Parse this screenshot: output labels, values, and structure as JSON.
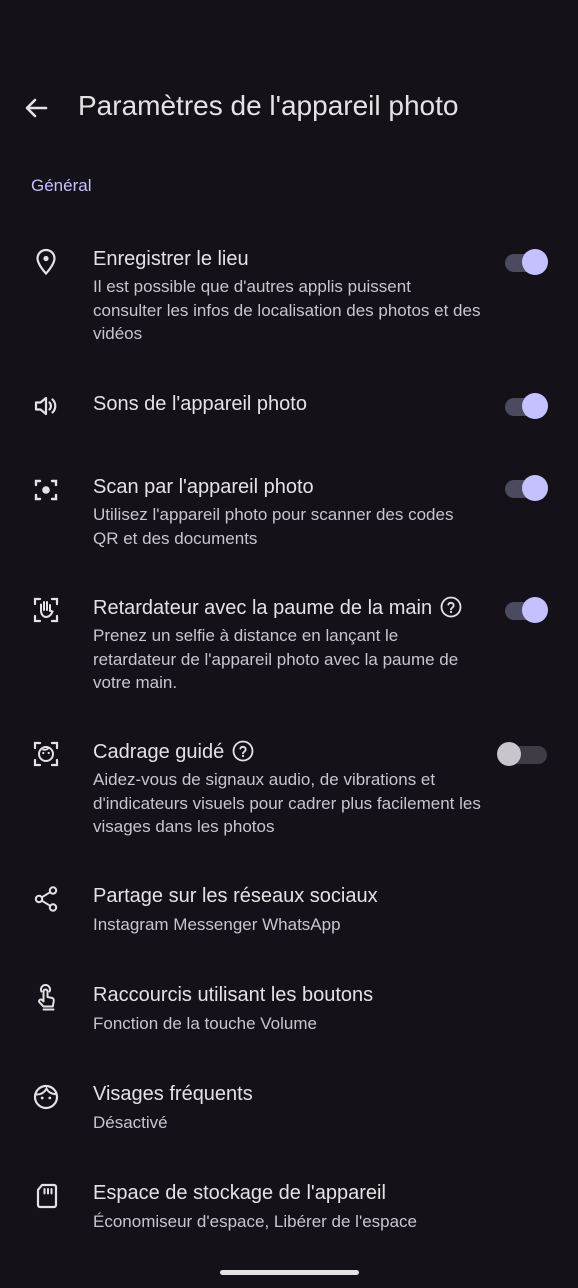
{
  "header": {
    "title": "Paramètres de l'appareil photo"
  },
  "section_label": "Général",
  "settings": [
    {
      "icon": "location-pin-icon",
      "title": "Enregistrer le lieu",
      "subtitle": "Il est possible que d'autres applis puissent consulter les infos de localisation des photos et des vidéos",
      "toggle": true
    },
    {
      "icon": "speaker-icon",
      "title": "Sons de l'appareil photo",
      "subtitle": "",
      "toggle": true
    },
    {
      "icon": "scan-icon",
      "title": "Scan par l'appareil photo",
      "subtitle": "Utilisez l'appareil photo pour scanner des codes QR et des documents",
      "toggle": true
    },
    {
      "icon": "palm-icon",
      "title": "Retardateur avec la paume de la main",
      "subtitle": "Prenez un selfie à distance en lançant le retardateur de l'appareil photo avec la paume de votre main.",
      "toggle": true,
      "help": true
    },
    {
      "icon": "face-frame-icon",
      "title": "Cadrage guidé",
      "subtitle": "Aidez-vous de signaux audio, de vibrations et d'indicateurs visuels pour cadrer plus facilement les visages dans les photos",
      "toggle": false,
      "help": true
    },
    {
      "icon": "share-icon",
      "title": "Partage sur les réseaux sociaux",
      "subtitle": "Instagram Messenger WhatsApp"
    },
    {
      "icon": "touch-button-icon",
      "title": "Raccourcis utilisant les boutons",
      "subtitle": "Fonction de la touche Volume"
    },
    {
      "icon": "face-icon",
      "title": "Visages fréquents",
      "subtitle": "Désactivé"
    },
    {
      "icon": "sd-card-icon",
      "title": "Espace de stockage de l'appareil",
      "subtitle": "Économiseur d'espace, Libérer de l'espace"
    }
  ],
  "colors": {
    "background": "#141218",
    "accent": "#c5c0ff",
    "text": "#e6e1e5",
    "subtext": "#cac4cf"
  }
}
